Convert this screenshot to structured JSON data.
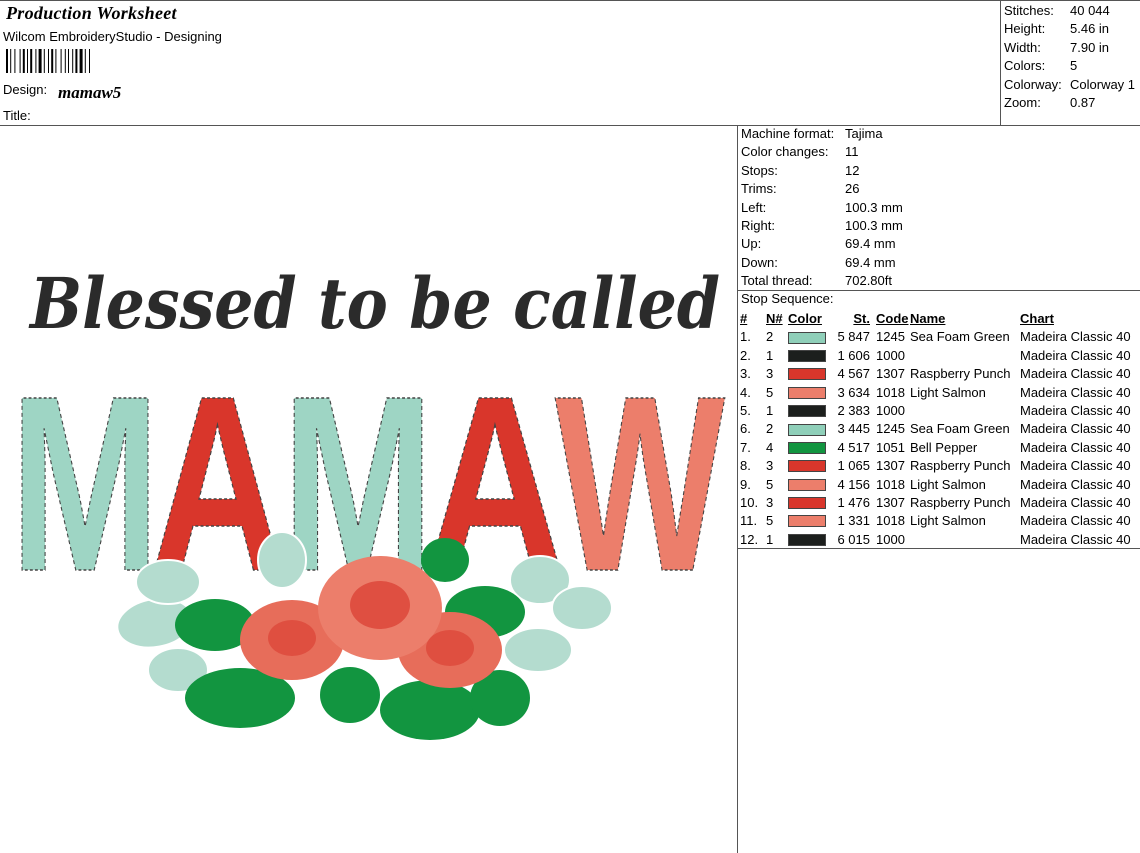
{
  "header": {
    "title": "Production Worksheet",
    "app": "Wilcom EmbroideryStudio - Designing",
    "design_label": "Design:",
    "design_value": "mamaw5",
    "title_label": "Title:"
  },
  "summary": [
    {
      "key": "Stitches:",
      "value": "40 044"
    },
    {
      "key": "Height:",
      "value": "5.46 in"
    },
    {
      "key": "Width:",
      "value": "7.90 in"
    },
    {
      "key": "Colors:",
      "value": "5"
    },
    {
      "key": "Colorway:",
      "value": "Colorway 1"
    },
    {
      "key": "Zoom:",
      "value": "0.87"
    }
  ],
  "machine": [
    {
      "key": "Machine format:",
      "value": "Tajima"
    },
    {
      "key": "Color changes:",
      "value": "11"
    },
    {
      "key": "Stops:",
      "value": "12"
    },
    {
      "key": "Trims:",
      "value": "26"
    },
    {
      "key": "Left:",
      "value": "100.3 mm"
    },
    {
      "key": "Right:",
      "value": "100.3 mm"
    },
    {
      "key": "Up:",
      "value": "69.4 mm"
    },
    {
      "key": "Down:",
      "value": "69.4 mm"
    },
    {
      "key": "Total thread:",
      "value": "702.80ft"
    }
  ],
  "stop_sequence": {
    "label": "Stop Sequence:",
    "headers": {
      "num": "#",
      "n": "N#",
      "color": "Color",
      "st": "St.",
      "code": "Code",
      "name": "Name",
      "chart": "Chart"
    },
    "rows": [
      {
        "num": "1.",
        "n": "2",
        "color": "#8fcfb9",
        "st": "5 847",
        "code": "1245",
        "name": "Sea Foam Green",
        "chart": "Madeira Classic 40"
      },
      {
        "num": "2.",
        "n": "1",
        "color": "#1c1f1d",
        "st": "1 606",
        "code": "1000",
        "name": "",
        "chart": "Madeira Classic 40"
      },
      {
        "num": "3.",
        "n": "3",
        "color": "#d9362b",
        "st": "4 567",
        "code": "1307",
        "name": "Raspberry Punch",
        "chart": "Madeira Classic 40"
      },
      {
        "num": "4.",
        "n": "5",
        "color": "#ec7e6b",
        "st": "3 634",
        "code": "1018",
        "name": "Light Salmon",
        "chart": "Madeira Classic 40"
      },
      {
        "num": "5.",
        "n": "1",
        "color": "#1c1f1d",
        "st": "2 383",
        "code": "1000",
        "name": "",
        "chart": "Madeira Classic 40"
      },
      {
        "num": "6.",
        "n": "2",
        "color": "#8fcfb9",
        "st": "3 445",
        "code": "1245",
        "name": "Sea Foam Green",
        "chart": "Madeira Classic 40"
      },
      {
        "num": "7.",
        "n": "4",
        "color": "#129540",
        "st": "4 517",
        "code": "1051",
        "name": "Bell Pepper",
        "chart": "Madeira Classic 40"
      },
      {
        "num": "8.",
        "n": "3",
        "color": "#d9362b",
        "st": "1 065",
        "code": "1307",
        "name": "Raspberry Punch",
        "chart": "Madeira Classic 40"
      },
      {
        "num": "9.",
        "n": "5",
        "color": "#ec7e6b",
        "st": "4 156",
        "code": "1018",
        "name": "Light Salmon",
        "chart": "Madeira Classic 40"
      },
      {
        "num": "10.",
        "n": "3",
        "color": "#d9362b",
        "st": "1 476",
        "code": "1307",
        "name": "Raspberry Punch",
        "chart": "Madeira Classic 40"
      },
      {
        "num": "11.",
        "n": "5",
        "color": "#ec7e6b",
        "st": "1 331",
        "code": "1018",
        "name": "Light Salmon",
        "chart": "Madeira Classic 40"
      },
      {
        "num": "12.",
        "n": "1",
        "color": "#1c1f1d",
        "st": "6 015",
        "code": "1000",
        "name": "",
        "chart": "Madeira Classic 40"
      }
    ]
  },
  "artwork": {
    "line1": "Blessed to be called",
    "line2": "MAMAW",
    "colors": {
      "seafoam": "#9ed5c4",
      "raspberry": "#d9362b",
      "salmon": "#ec7e6b",
      "green": "#129540",
      "black": "#2b2b2b"
    }
  }
}
